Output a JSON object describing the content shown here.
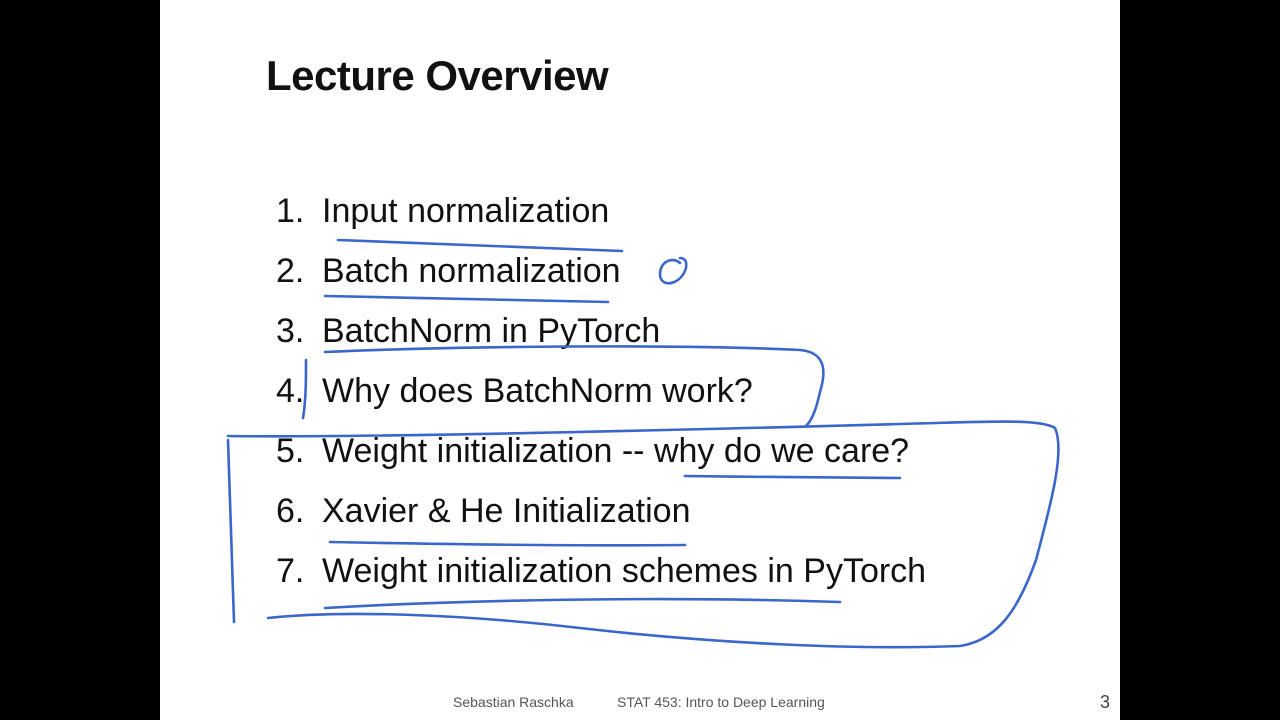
{
  "slide": {
    "title": "Lecture Overview",
    "items": [
      {
        "number": "1.",
        "text": "Input normalization"
      },
      {
        "number": "2.",
        "text": "Batch normalization"
      },
      {
        "number": "3.",
        "text": "BatchNorm in PyTorch"
      },
      {
        "number": "4.",
        "text": "Why does BatchNorm work?"
      },
      {
        "number": "5.",
        "text": "Weight initialization -- why do we care?"
      },
      {
        "number": "6.",
        "text": "Xavier & He Initialization"
      },
      {
        "number": "7.",
        "text": "Weight initialization schemes in PyTorch"
      }
    ],
    "footer": {
      "author": "Sebastian Raschka",
      "course": "STAT 453: Intro to Deep Learning"
    },
    "page_number": "3",
    "annotation_color": "#3a67c9"
  }
}
